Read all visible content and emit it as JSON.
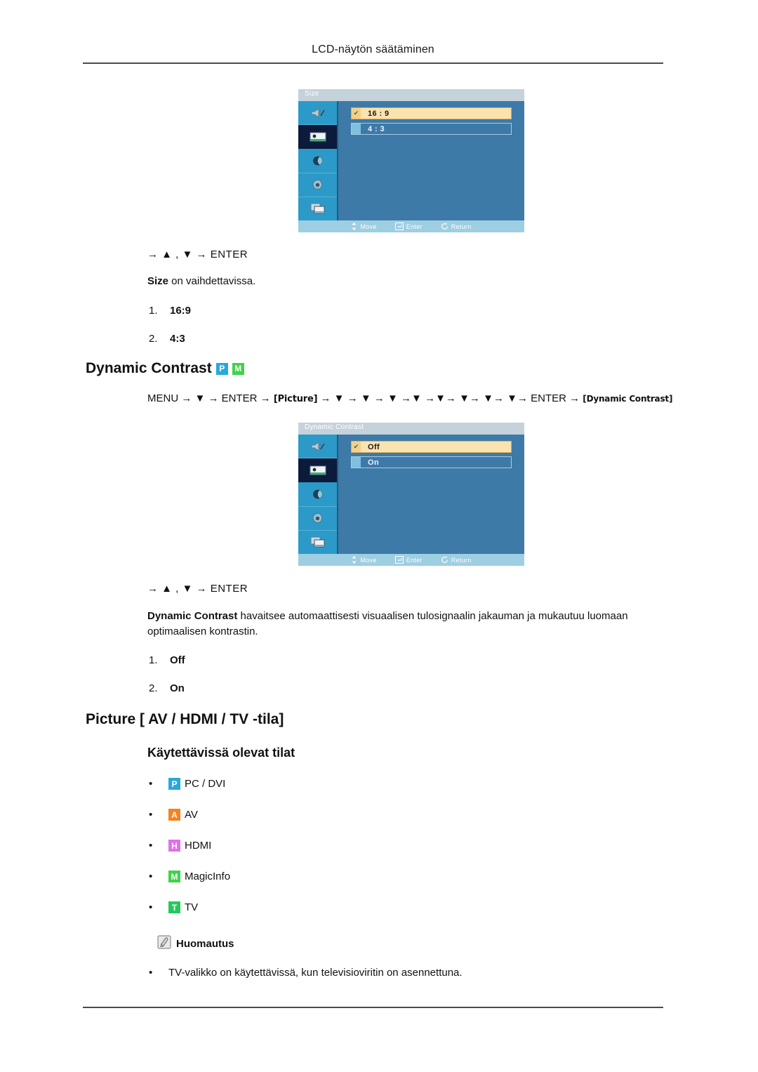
{
  "page": {
    "running_header": "LCD-näytön säätäminen"
  },
  "osd_size": {
    "title": "Size",
    "options": [
      {
        "label": "16 : 9",
        "selected": true
      },
      {
        "label": "4 : 3",
        "selected": false
      }
    ],
    "footer": [
      {
        "icon": "move-icon",
        "label": "Move"
      },
      {
        "icon": "enter-icon",
        "label": "Enter"
      },
      {
        "icon": "return-icon",
        "label": "Return"
      }
    ],
    "sidebar_icons": [
      "speaker-icon",
      "picture-icon",
      "moon-icon",
      "gear-icon",
      "multi-display-icon"
    ],
    "active_sidebar_index": 1
  },
  "section_size": {
    "nav_line": "→ ▲ , ▼ → ENTER",
    "description_bold": "Size",
    "description_rest": " on vaihdettavissa.",
    "items": [
      {
        "num": "1.",
        "label": "16:9"
      },
      {
        "num": "2.",
        "label": "4:3"
      }
    ]
  },
  "section_dynamic_contrast": {
    "heading": "Dynamic Contrast",
    "heading_badges": [
      {
        "letter": "P",
        "name": "pc-dvi-mode-badge"
      },
      {
        "letter": "M",
        "name": "magicinfo-mode-badge"
      }
    ],
    "menu_path": {
      "prefix": "MENU → ▼ → ENTER → ",
      "tag1": "[Picture]",
      "middle": " → ▼ → ▼ → ▼ →▼ →▼→ ▼→ ▼→ ▼→ ENTER → ",
      "tag2": "[Dynamic Contrast]"
    },
    "nav_line": "→ ▲ , ▼ → ENTER",
    "description_bold": "Dynamic Contrast",
    "description_rest": " havaitsee automaattisesti visuaalisen tulosignaalin jakauman ja mukautuu luomaan optimaalisen kontrastin.",
    "items": [
      {
        "num": "1.",
        "label": "Off"
      },
      {
        "num": "2.",
        "label": "On"
      }
    ]
  },
  "osd_dynamic_contrast": {
    "title": "Dynamic Contrast",
    "options": [
      {
        "label": "Off",
        "selected": true
      },
      {
        "label": "On",
        "selected": false
      }
    ],
    "footer": [
      {
        "icon": "move-icon",
        "label": "Move"
      },
      {
        "icon": "enter-icon",
        "label": "Enter"
      },
      {
        "icon": "return-icon",
        "label": "Return"
      }
    ],
    "sidebar_icons": [
      "speaker-icon",
      "picture-icon",
      "moon-icon",
      "gear-icon",
      "multi-display-icon"
    ],
    "active_sidebar_index": 1
  },
  "section_picture": {
    "heading": "Picture [ AV / HDMI / TV -tila]",
    "subheading": "Käytettävissä olevat tilat",
    "modes": [
      {
        "bullet": "•",
        "letter": "P",
        "badge_class": "badge-p",
        "label": "PC / DVI",
        "name": "mode-pc-dvi"
      },
      {
        "bullet": "•",
        "letter": "A",
        "badge_class": "badge-a",
        "label": "AV",
        "name": "mode-av"
      },
      {
        "bullet": "•",
        "letter": "H",
        "badge_class": "badge-h",
        "label": "HDMI",
        "name": "mode-hdmi"
      },
      {
        "bullet": "•",
        "letter": "M",
        "badge_class": "badge-m",
        "label": "MagicInfo",
        "name": "mode-magicinfo"
      },
      {
        "bullet": "•",
        "letter": "T",
        "badge_class": "badge-t",
        "label": "TV",
        "name": "mode-tv"
      }
    ],
    "note_title": "Huomautus",
    "note_bullet": "•",
    "note_text": "TV-valikko on käytettävissä, kun televisioviritin on asennettuna."
  },
  "colors": {
    "osd_panel": "#3e7aa8",
    "osd_sidebar": "#2b9ac9",
    "osd_sidebar_active": "#0c1a3c",
    "osd_titlebar": "#c6d2da",
    "osd_footer": "#9ecee2",
    "option_selected": "#fbe3b0",
    "badge_p": "#29a8dd",
    "badge_a": "#f58220",
    "badge_h": "#e070e8",
    "badge_m": "#3fd24a",
    "badge_t": "#24c95e"
  }
}
